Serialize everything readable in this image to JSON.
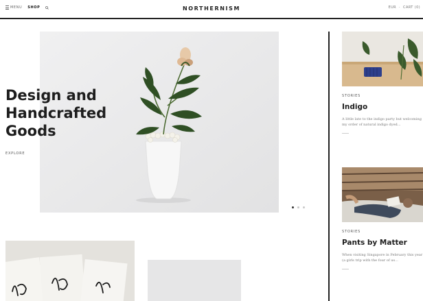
{
  "header": {
    "menu_label": "MENU",
    "shop_label": "SHOP",
    "brand": "NORTHERNISM",
    "currency": "EUR",
    "separator": "·",
    "cart_label": "CART (0)"
  },
  "hero": {
    "title": "Design and Handcrafted Goods",
    "explore_label": "EXPLORE",
    "slide_count": 3,
    "active_slide": 1
  },
  "stories": [
    {
      "category": "STORIES",
      "title": "Indigo",
      "excerpt": "A little late to the indigo party but welcoming my order of natural indigo dyed..."
    },
    {
      "category": "STORIES",
      "title": "Pants by Matter",
      "excerpt": "When visiting Singapore in February this year (a girls trip with the four of us..."
    }
  ],
  "icons": {
    "menu": "menu-icon",
    "search": "search-icon"
  }
}
